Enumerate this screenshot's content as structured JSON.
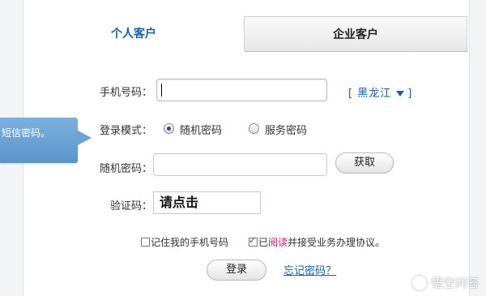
{
  "tabs": {
    "personal": "个人客户",
    "enterprise": "企业客户"
  },
  "form": {
    "phone_label": "手机号码：",
    "phone_value": "",
    "region": "[ 黑龙江",
    "region_close": "]",
    "login_mode_label": "登录模式：",
    "mode_random": "随机密码",
    "mode_service": "服务密码",
    "selected_mode": "随机密码",
    "random_pwd_label": "随机密码：",
    "random_pwd_value": "",
    "get_button": "获取",
    "captcha_label": "验证码：",
    "captcha_text": "请点击"
  },
  "options": {
    "remember_label": "记住我的手机号码",
    "remember_checked": false,
    "agree_prefix": "已",
    "agree_link": "阅读",
    "agree_suffix": "并接受业务办理协议。",
    "agree_checked": true
  },
  "actions": {
    "login_button": "登录",
    "forgot_link": "忘记密码？"
  },
  "tooltip": {
    "text": "短信密码。"
  },
  "watermark": {
    "text": "悟空问答",
    "icon": "chat-bubble-icon"
  },
  "colors": {
    "accent_blue": "#1a5faa",
    "tooltip_blue": "#6aa2d2",
    "link_pink": "#e0116b"
  }
}
